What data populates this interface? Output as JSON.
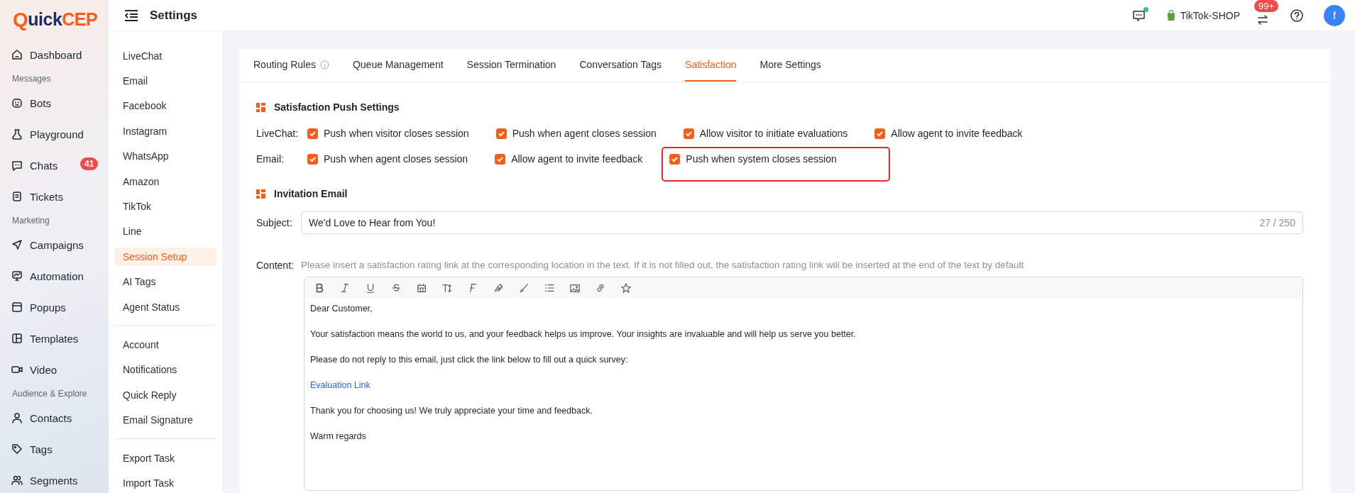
{
  "logo": {
    "mark": "Q",
    "text": "uick",
    "accent": "CEP"
  },
  "nav": [
    {
      "kind": "item",
      "label": "Dashboard"
    },
    {
      "kind": "section",
      "label": "Messages"
    },
    {
      "kind": "item",
      "label": "Bots"
    },
    {
      "kind": "item",
      "label": "Playground"
    },
    {
      "kind": "item",
      "label": "Chats",
      "badge": "41"
    },
    {
      "kind": "item",
      "label": "Tickets"
    },
    {
      "kind": "section",
      "label": "Marketing"
    },
    {
      "kind": "item",
      "label": "Campaigns"
    },
    {
      "kind": "item",
      "label": "Automation"
    },
    {
      "kind": "item",
      "label": "Popups"
    },
    {
      "kind": "item",
      "label": "Templates"
    },
    {
      "kind": "item",
      "label": "Video"
    },
    {
      "kind": "section",
      "label": "Audience & Explore"
    },
    {
      "kind": "item",
      "label": "Contacts"
    },
    {
      "kind": "item",
      "label": "Tags"
    },
    {
      "kind": "item",
      "label": "Segments"
    }
  ],
  "header": {
    "title": "Settings",
    "chat_online": true,
    "shop": "TikTok-SHOP",
    "notification_badge": "99+",
    "avatar": "f"
  },
  "settings_menu": [
    {
      "items": [
        {
          "label": "LiveChat",
          "selected": false
        },
        {
          "label": "Email",
          "selected": false
        },
        {
          "label": "Facebook",
          "selected": false
        },
        {
          "label": "Instagram",
          "selected": false
        },
        {
          "label": "WhatsApp",
          "selected": false
        },
        {
          "label": "Amazon",
          "selected": false
        },
        {
          "label": "TikTok",
          "selected": false
        },
        {
          "label": "Line",
          "selected": false
        },
        {
          "label": "Session Setup",
          "selected": true
        },
        {
          "label": "AI Tags",
          "selected": false
        },
        {
          "label": "Agent Status",
          "selected": false
        }
      ]
    },
    {
      "items": [
        {
          "label": "Account",
          "selected": false
        },
        {
          "label": "Notifications",
          "selected": false
        },
        {
          "label": "Quick Reply",
          "selected": false
        },
        {
          "label": "Email Signature",
          "selected": false
        }
      ]
    },
    {
      "items": [
        {
          "label": "Export Task",
          "selected": false
        },
        {
          "label": "Import Task",
          "selected": false
        }
      ]
    }
  ],
  "tabs": [
    {
      "label": "Routing Rules",
      "info": true,
      "selected": false
    },
    {
      "label": "Queue Management",
      "info": false,
      "selected": false
    },
    {
      "label": "Session Termination",
      "info": false,
      "selected": false
    },
    {
      "label": "Conversation Tags",
      "info": false,
      "selected": false
    },
    {
      "label": "Satisfaction",
      "info": false,
      "selected": true
    },
    {
      "label": "More Settings",
      "info": false,
      "selected": false
    }
  ],
  "push_settings": {
    "title": "Satisfaction Push Settings",
    "rows": [
      {
        "label": "LiveChat:",
        "options": [
          {
            "label": "Push when visitor closes session",
            "checked": true,
            "highlighted": false
          },
          {
            "label": "Push when agent closes session",
            "checked": true,
            "highlighted": false
          },
          {
            "label": "Allow visitor to initiate evaluations",
            "checked": true,
            "highlighted": false
          },
          {
            "label": "Allow agent to invite feedback",
            "checked": true,
            "highlighted": false
          }
        ]
      },
      {
        "label": "Email:",
        "options": [
          {
            "label": "Push when agent closes session",
            "checked": true,
            "highlighted": false
          },
          {
            "label": "Allow agent to invite feedback",
            "checked": true,
            "highlighted": false
          },
          {
            "label": "Push when system closes session",
            "checked": true,
            "highlighted": true
          }
        ]
      }
    ]
  },
  "invitation": {
    "title": "Invitation Email",
    "subject_label": "Subject:",
    "subject": "We'd Love to Hear from You!",
    "counter": "27 / 250",
    "content_label": "Content:",
    "hint": "Please insert a satisfaction rating link at the corresponding location in the text. If it is not filled out, the satisfaction rating link will be inserted at the end of the text by default",
    "toolbar": [
      {
        "kind": "bold"
      },
      {
        "kind": "italic"
      },
      {
        "kind": "underline"
      },
      {
        "kind": "strike"
      },
      {
        "kind": "table"
      },
      {
        "kind": "text-size"
      },
      {
        "kind": "font"
      },
      {
        "kind": "highlighter"
      },
      {
        "kind": "brush"
      },
      {
        "kind": "list"
      },
      {
        "kind": "image"
      },
      {
        "kind": "link"
      },
      {
        "kind": "star"
      }
    ],
    "body": [
      {
        "kind": "text",
        "text": "Dear Customer,"
      },
      {
        "kind": "text",
        "text": "Your satisfaction means the world to us, and your feedback helps us improve. Your insights are invaluable and will help us serve you better."
      },
      {
        "kind": "text",
        "text": "Please do not reply to this email, just click the link below to fill out a quick survey:"
      },
      {
        "kind": "link",
        "text": "Evaluation Link"
      },
      {
        "kind": "text",
        "text": "Thank you for choosing us! We truly appreciate your time and feedback."
      },
      {
        "kind": "text",
        "text": "Warm regards"
      }
    ]
  }
}
